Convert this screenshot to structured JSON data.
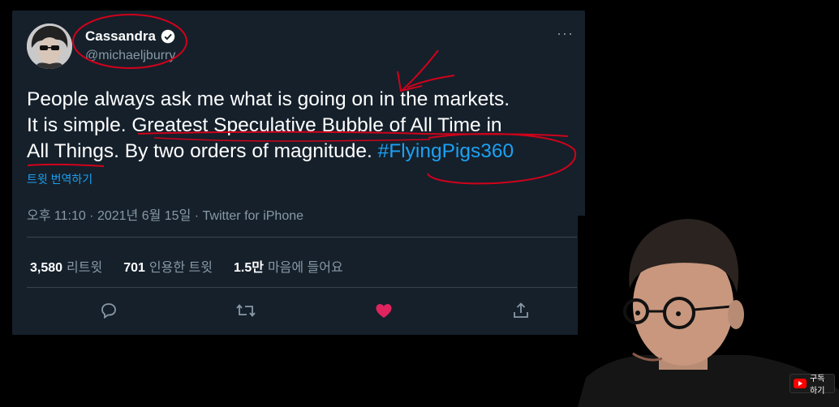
{
  "tweet": {
    "display_name": "Cassandra",
    "handle": "@michaeljburry",
    "body_line1": "People always ask me what is going on in the markets.",
    "body_line2a": "It is simple. ",
    "body_line2b": "Greatest Speculative Bubble of All Time in",
    "body_line3a": "All Things",
    "body_line3b": ". By two orders of magnitude. ",
    "hashtag": "#FlyingPigs360",
    "translate_label": "트윗 번역하기",
    "meta": "오후 11:10 · 2021년 6월 15일 · Twitter for iPhone",
    "stats": {
      "retweets_count": "3,580",
      "retweets_label": "리트윗",
      "quotes_count": "701",
      "quotes_label": "인용한 트윗",
      "likes_count": "1.5만",
      "likes_label": "마음에 들어요"
    },
    "more_label": "···",
    "icons": [
      "reply-icon",
      "retweet-icon",
      "like-icon",
      "share-icon"
    ],
    "colors": {
      "background": "#15202b",
      "link": "#1da1f2",
      "like": "#e0245e",
      "annotation": "#d0021b"
    }
  },
  "overlay": {
    "subscribe_label": "구독하기"
  }
}
